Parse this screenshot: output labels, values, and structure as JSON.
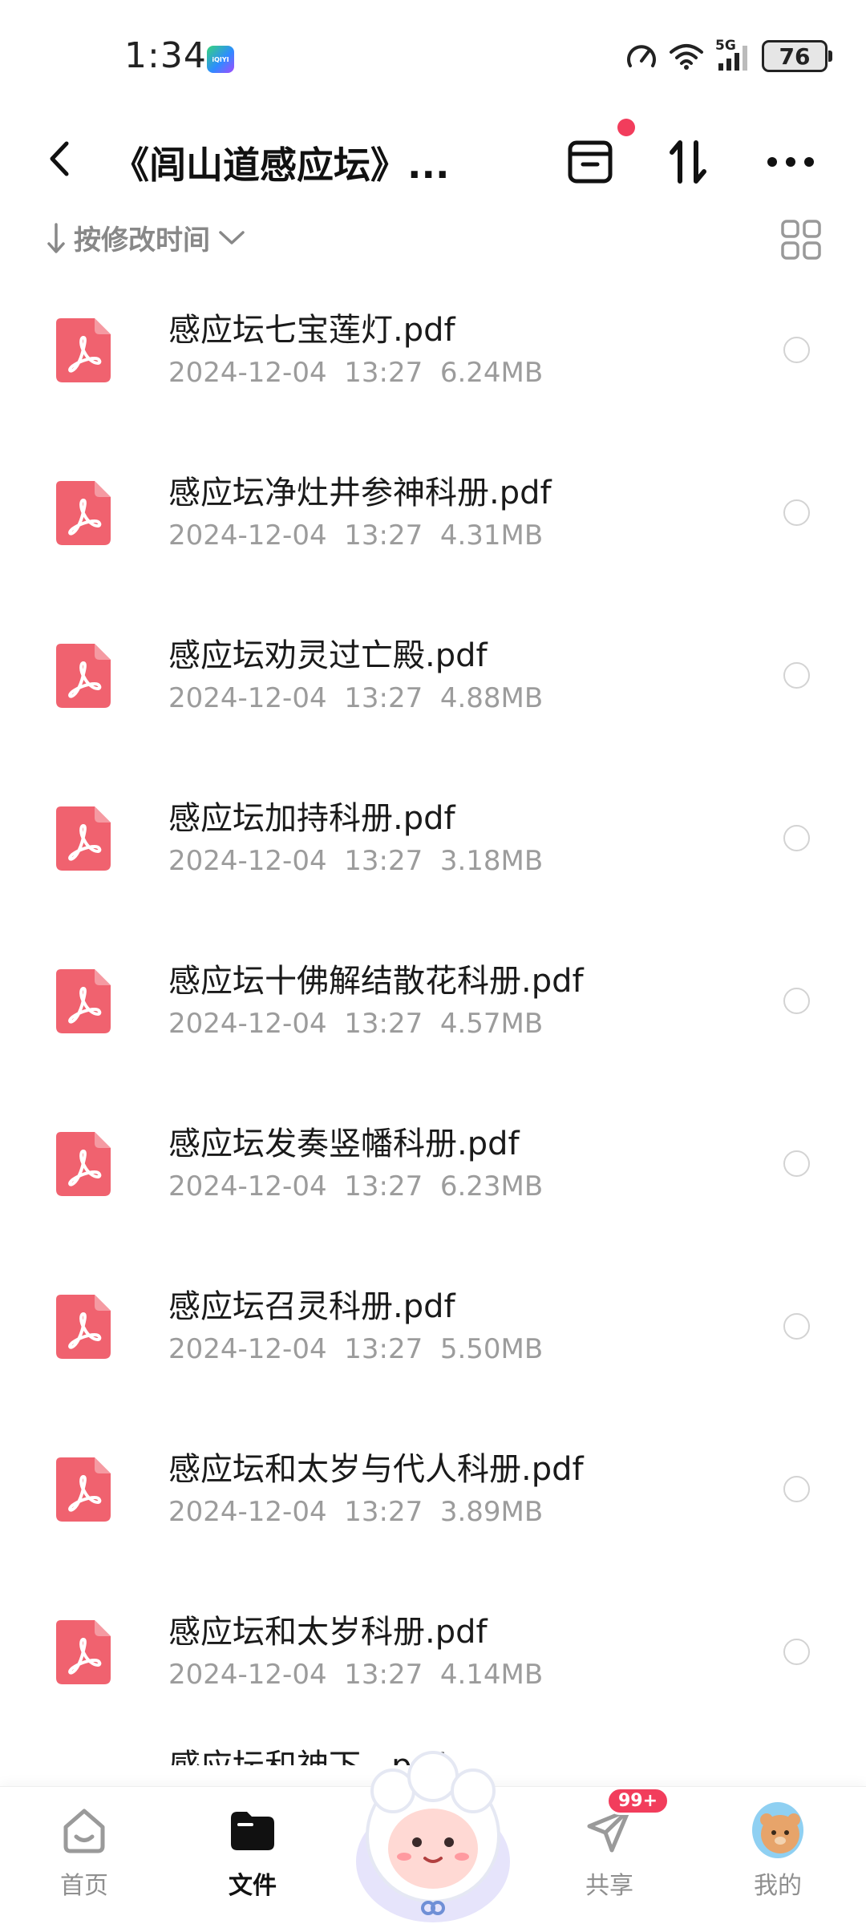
{
  "status_bar": {
    "time": "1:34",
    "app_badge": "iQIYI",
    "network": "5G",
    "battery": "76"
  },
  "header": {
    "title": "《闾山道感应坛》..."
  },
  "sort": {
    "label": "按修改时间"
  },
  "files": [
    {
      "name": "感应坛七宝莲灯.pdf",
      "date": "2024-12-04",
      "time": "13:27",
      "size": "6.24MB"
    },
    {
      "name": "感应坛净灶井参神科册.pdf",
      "date": "2024-12-04",
      "time": "13:27",
      "size": "4.31MB"
    },
    {
      "name": "感应坛劝灵过亡殿.pdf",
      "date": "2024-12-04",
      "time": "13:27",
      "size": "4.88MB"
    },
    {
      "name": "感应坛加持科册.pdf",
      "date": "2024-12-04",
      "time": "13:27",
      "size": "3.18MB"
    },
    {
      "name": "感应坛十佛解结散花科册.pdf",
      "date": "2024-12-04",
      "time": "13:27",
      "size": "4.57MB"
    },
    {
      "name": "感应坛发奏竖幡科册.pdf",
      "date": "2024-12-04",
      "time": "13:27",
      "size": "6.23MB"
    },
    {
      "name": "感应坛召灵科册.pdf",
      "date": "2024-12-04",
      "time": "13:27",
      "size": "5.50MB"
    },
    {
      "name": "感应坛和太岁与代人科册.pdf",
      "date": "2024-12-04",
      "time": "13:27",
      "size": "3.89MB"
    },
    {
      "name": "感应坛和太岁科册.pdf",
      "date": "2024-12-04",
      "time": "13:27",
      "size": "4.14MB"
    },
    {
      "name": "感应坛和神下...pdf",
      "date": "",
      "time": "",
      "size": ""
    }
  ],
  "tabs": [
    {
      "label": "首页",
      "icon": "home-icon"
    },
    {
      "label": "文件",
      "icon": "folder-icon"
    },
    {
      "label": "共享",
      "icon": "paper-plane-icon",
      "badge": "99+"
    },
    {
      "label": "我的",
      "icon": "avatar"
    }
  ],
  "colors": {
    "pdf_red": "#f0626f",
    "accent_red": "#f23d5c",
    "meta_gray": "#9c9c9c"
  }
}
